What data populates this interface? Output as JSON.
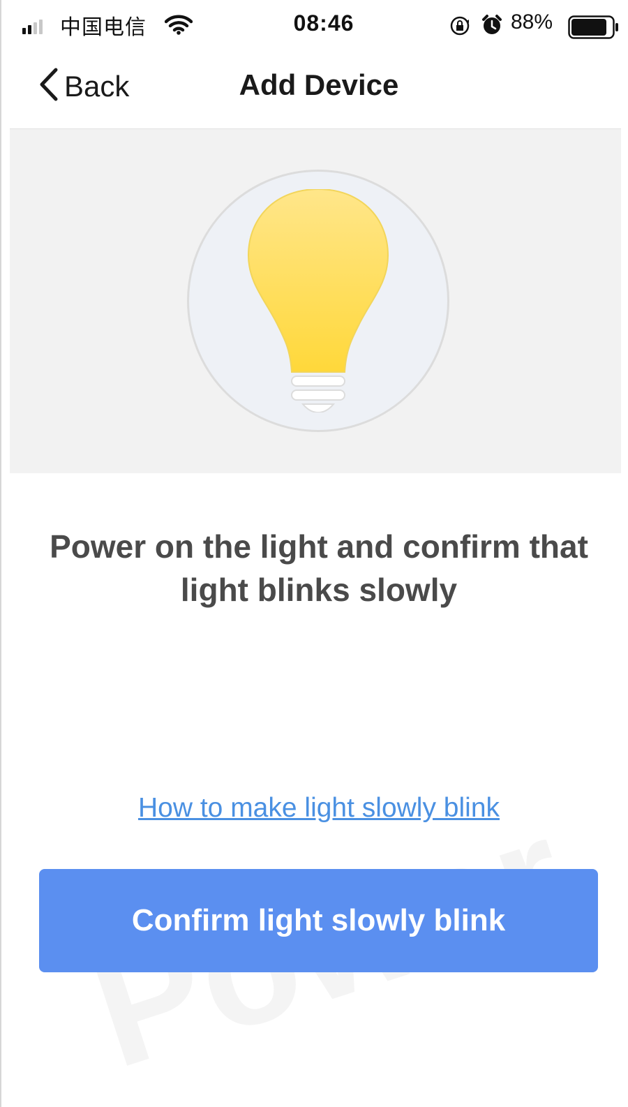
{
  "status_bar": {
    "carrier": "中国电信",
    "time": "08:46",
    "battery_percent": "88%",
    "battery_level": 0.88,
    "signal_bars_active": 2,
    "signal_bars_total": 4,
    "icons": [
      "signal-icon",
      "wifi-icon",
      "orientation-lock-icon",
      "alarm-icon",
      "battery-icon"
    ]
  },
  "nav": {
    "back_label": "Back",
    "title": "Add Device"
  },
  "illustration": {
    "icon": "light-bulb-icon",
    "bulb_color": "#ffd83a",
    "circle_color": "#eef1f6"
  },
  "instruction": "Power on the light and confirm that light blinks slowly",
  "help_link": "How to make light slowly blink",
  "confirm_button": "Confirm light slowly blink",
  "colors": {
    "accent": "#5b8ff0",
    "link": "#4a90e2",
    "text_dark": "#1a1a1a",
    "text_body": "#4a4a4a",
    "band_bg": "#f2f2f2"
  }
}
